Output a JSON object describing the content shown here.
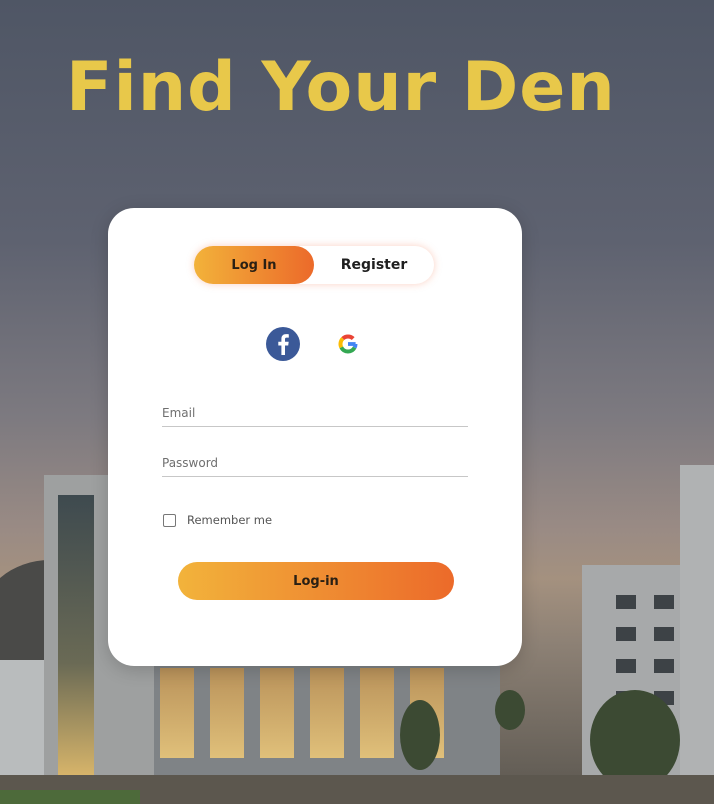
{
  "headline": "Find Your Den",
  "auth_toggle": {
    "login_label": "Log In",
    "register_label": "Register",
    "active": "login"
  },
  "social": {
    "facebook_icon": "facebook-icon",
    "google_icon": "google-icon"
  },
  "form": {
    "email_placeholder": "Email",
    "email_value": "",
    "password_placeholder": "Password",
    "password_value": "",
    "remember_label": "Remember me",
    "remember_checked": false,
    "submit_label": "Log-in"
  },
  "colors": {
    "headline": "#e8c84a",
    "accent_start": "#f2b23a",
    "accent_end": "#ec6a2a",
    "facebook_blue": "#3b5998"
  }
}
